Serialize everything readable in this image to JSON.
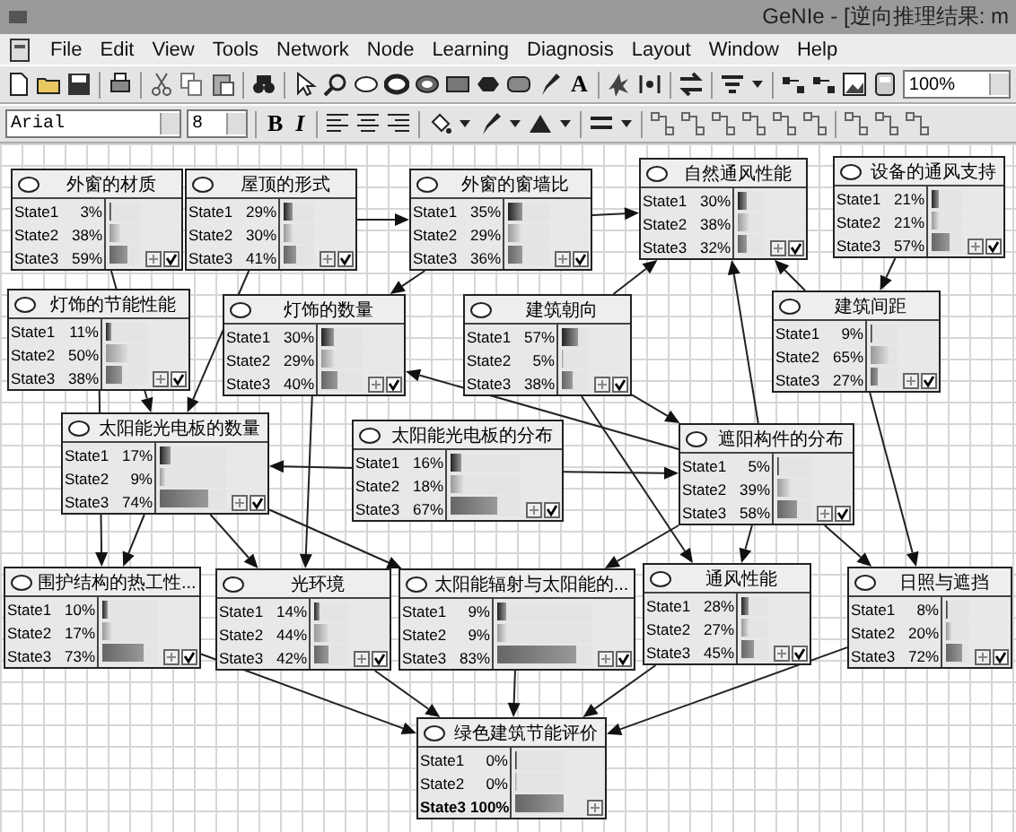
{
  "window": {
    "title": "GeNIe - [逆向推理结果: m"
  },
  "menu": [
    "File",
    "Edit",
    "View",
    "Tools",
    "Network",
    "Node",
    "Learning",
    "Diagnosis",
    "Layout",
    "Window",
    "Help"
  ],
  "toolbar": {
    "text_tool": "A",
    "zoom": "100%"
  },
  "format_bar": {
    "font": "Arial",
    "size": "8",
    "bold": "B",
    "italic": "I"
  },
  "nodes": [
    {
      "title": "外窗的材质",
      "observed": false,
      "states": [
        {
          "name": "State1",
          "value": "3%",
          "level": 0.03
        },
        {
          "name": "State2",
          "value": "38%",
          "level": 0.38
        },
        {
          "name": "State3",
          "value": "59%",
          "level": 0.59
        }
      ]
    },
    {
      "title": "屋顶的形式",
      "observed": false,
      "states": [
        {
          "name": "State1",
          "value": "29%",
          "level": 0.29
        },
        {
          "name": "State2",
          "value": "30%",
          "level": 0.3
        },
        {
          "name": "State3",
          "value": "41%",
          "level": 0.41
        }
      ]
    },
    {
      "title": "外窗的窗墙比",
      "observed": false,
      "states": [
        {
          "name": "State1",
          "value": "35%",
          "level": 0.35
        },
        {
          "name": "State2",
          "value": "29%",
          "level": 0.29
        },
        {
          "name": "State3",
          "value": "36%",
          "level": 0.36
        }
      ]
    },
    {
      "title": "自然通风性能",
      "observed": false,
      "states": [
        {
          "name": "State1",
          "value": "30%",
          "level": 0.3
        },
        {
          "name": "State2",
          "value": "38%",
          "level": 0.38
        },
        {
          "name": "State3",
          "value": "32%",
          "level": 0.32
        }
      ]
    },
    {
      "title": "设备的通风支持",
      "observed": false,
      "states": [
        {
          "name": "State1",
          "value": "21%",
          "level": 0.21
        },
        {
          "name": "State2",
          "value": "21%",
          "level": 0.21
        },
        {
          "name": "State3",
          "value": "57%",
          "level": 0.57
        }
      ]
    },
    {
      "title": "灯饰的节能性能",
      "observed": false,
      "states": [
        {
          "name": "State1",
          "value": "11%",
          "level": 0.11
        },
        {
          "name": "State2",
          "value": "50%",
          "level": 0.5
        },
        {
          "name": "State3",
          "value": "38%",
          "level": 0.38
        }
      ]
    },
    {
      "title": "灯饰的数量",
      "observed": false,
      "states": [
        {
          "name": "State1",
          "value": "30%",
          "level": 0.3
        },
        {
          "name": "State2",
          "value": "29%",
          "level": 0.29
        },
        {
          "name": "State3",
          "value": "40%",
          "level": 0.4
        }
      ]
    },
    {
      "title": "建筑朝向",
      "observed": false,
      "states": [
        {
          "name": "State1",
          "value": "57%",
          "level": 0.57
        },
        {
          "name": "State2",
          "value": "5%",
          "level": 0.05
        },
        {
          "name": "State3",
          "value": "38%",
          "level": 0.38
        }
      ]
    },
    {
      "title": "建筑间距",
      "observed": false,
      "states": [
        {
          "name": "State1",
          "value": "9%",
          "level": 0.09
        },
        {
          "name": "State2",
          "value": "65%",
          "level": 0.65
        },
        {
          "name": "State3",
          "value": "27%",
          "level": 0.27
        }
      ]
    },
    {
      "title": "太阳能光电板的数量",
      "observed": false,
      "states": [
        {
          "name": "State1",
          "value": "17%",
          "level": 0.17
        },
        {
          "name": "State2",
          "value": "9%",
          "level": 0.09
        },
        {
          "name": "State3",
          "value": "74%",
          "level": 0.74
        }
      ]
    },
    {
      "title": "太阳能光电板的分布",
      "observed": false,
      "states": [
        {
          "name": "State1",
          "value": "16%",
          "level": 0.16
        },
        {
          "name": "State2",
          "value": "18%",
          "level": 0.18
        },
        {
          "name": "State3",
          "value": "67%",
          "level": 0.67
        }
      ]
    },
    {
      "title": "遮阳构件的分布",
      "observed": false,
      "states": [
        {
          "name": "State1",
          "value": "5%",
          "level": 0.05
        },
        {
          "name": "State2",
          "value": "39%",
          "level": 0.39
        },
        {
          "name": "State3",
          "value": "58%",
          "level": 0.58
        }
      ]
    },
    {
      "title": "围护结构的热工性...",
      "observed": false,
      "states": [
        {
          "name": "State1",
          "value": "10%",
          "level": 0.1
        },
        {
          "name": "State2",
          "value": "17%",
          "level": 0.17
        },
        {
          "name": "State3",
          "value": "73%",
          "level": 0.73
        }
      ]
    },
    {
      "title": "光环境",
      "observed": false,
      "states": [
        {
          "name": "State1",
          "value": "14%",
          "level": 0.14
        },
        {
          "name": "State2",
          "value": "44%",
          "level": 0.44
        },
        {
          "name": "State3",
          "value": "42%",
          "level": 0.42
        }
      ]
    },
    {
      "title": "太阳能辐射与太阳能的...",
      "observed": false,
      "states": [
        {
          "name": "State1",
          "value": "9%",
          "level": 0.09
        },
        {
          "name": "State2",
          "value": "9%",
          "level": 0.09
        },
        {
          "name": "State3",
          "value": "83%",
          "level": 0.83
        }
      ]
    },
    {
      "title": "通风性能",
      "observed": false,
      "states": [
        {
          "name": "State1",
          "value": "28%",
          "level": 0.28
        },
        {
          "name": "State2",
          "value": "27%",
          "level": 0.27
        },
        {
          "name": "State3",
          "value": "45%",
          "level": 0.45
        }
      ]
    },
    {
      "title": "日照与遮挡",
      "observed": false,
      "states": [
        {
          "name": "State1",
          "value": "8%",
          "level": 0.08
        },
        {
          "name": "State2",
          "value": "20%",
          "level": 0.2
        },
        {
          "name": "State3",
          "value": "72%",
          "level": 0.72
        }
      ]
    },
    {
      "title": "绿色建筑节能评价",
      "observed": true,
      "states": [
        {
          "name": "State1",
          "value": "0%",
          "level": 0
        },
        {
          "name": "State2",
          "value": "0%",
          "level": 0
        },
        {
          "name": "State3",
          "value": "100%",
          "level": 1
        }
      ]
    }
  ],
  "canvas": {
    "grid": true
  }
}
